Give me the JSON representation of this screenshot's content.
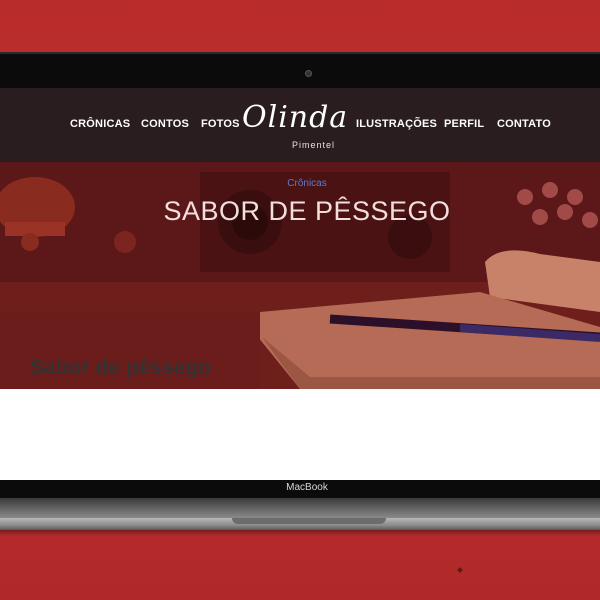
{
  "nav": {
    "left_items": [
      "CRÔNICAS",
      "CONTOS",
      "FOTOS"
    ],
    "right_items": [
      "ILUSTRAÇÕES",
      "PERFIL",
      "CONTATO"
    ]
  },
  "logo": {
    "script_text": "Olinda",
    "subtitle": "Pimentel"
  },
  "hero": {
    "category": "Crônicas",
    "title": "SABOR DE PÊSSEGO"
  },
  "article": {
    "title": "Sabor de pêssego"
  },
  "device": {
    "label": "MacBook"
  },
  "colors": {
    "background": "#bf2f2f",
    "navbar": "#2a1d1f",
    "hero_tint": "#6b1d1c",
    "category_link": "#5d7bd0",
    "article_title": "#333333"
  }
}
